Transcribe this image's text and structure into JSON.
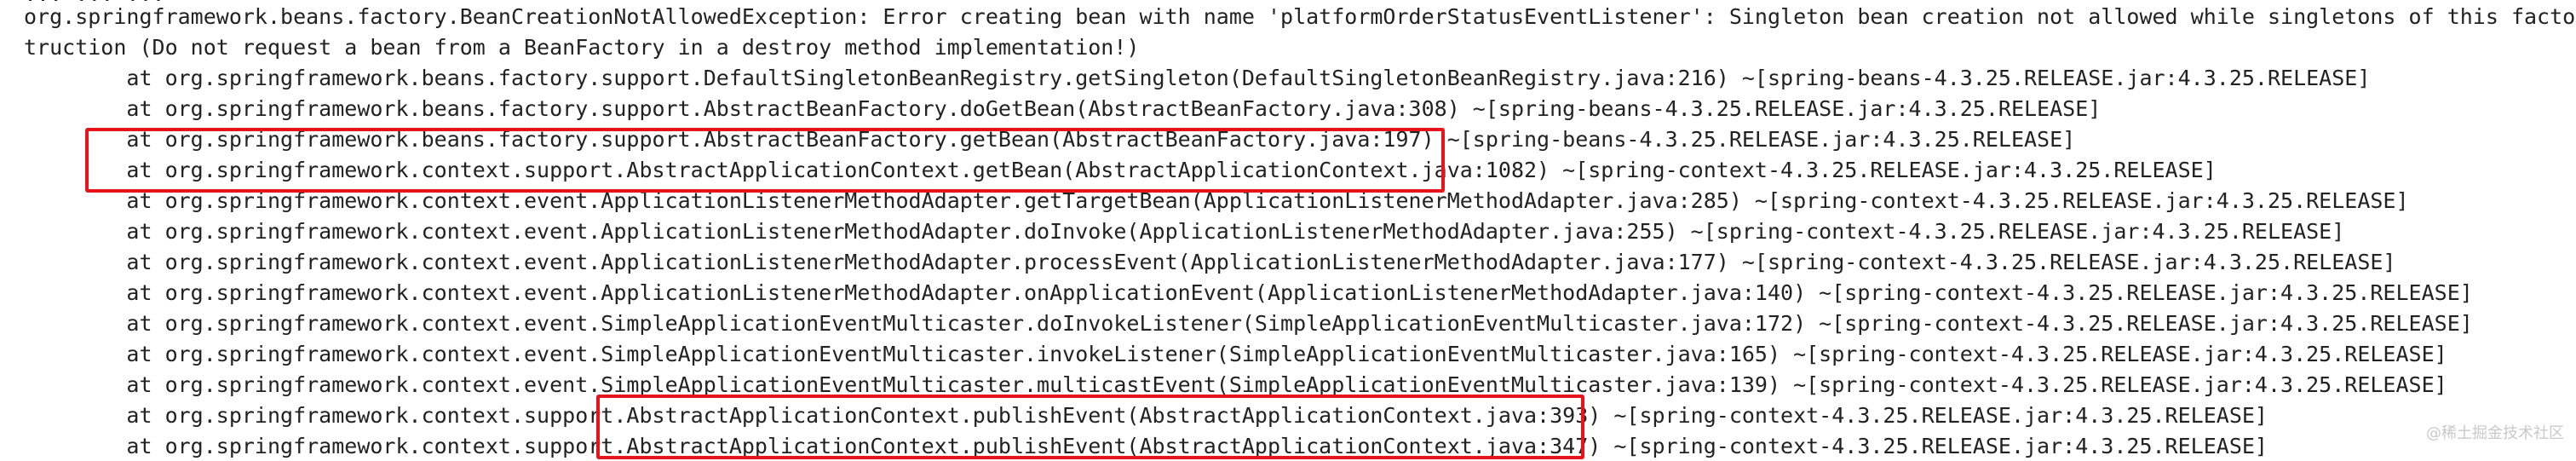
{
  "log": {
    "partial_top_line": "... ... ...",
    "lines": [
      "org.springframework.beans.factory.BeanCreationNotAllowedException: Error creating bean with name 'platformOrderStatusEventListener': Singleton bean creation not allowed while singletons of this factory are in destruction (Do not request a bean from a BeanFactory in a destroy method implementation!)",
      "truction (Do not request a bean from a BeanFactory in a destroy method implementation!)",
      "        at org.springframework.beans.factory.support.DefaultSingletonBeanRegistry.getSingleton(DefaultSingletonBeanRegistry.java:216) ~[spring-beans-4.3.25.RELEASE.jar:4.3.25.RELEASE]",
      "        at org.springframework.beans.factory.support.AbstractBeanFactory.doGetBean(AbstractBeanFactory.java:308) ~[spring-beans-4.3.25.RELEASE.jar:4.3.25.RELEASE]",
      "        at org.springframework.beans.factory.support.AbstractBeanFactory.getBean(AbstractBeanFactory.java:197) ~[spring-beans-4.3.25.RELEASE.jar:4.3.25.RELEASE]",
      "        at org.springframework.context.support.AbstractApplicationContext.getBean(AbstractApplicationContext.java:1082) ~[spring-context-4.3.25.RELEASE.jar:4.3.25.RELEASE]",
      "        at org.springframework.context.event.ApplicationListenerMethodAdapter.getTargetBean(ApplicationListenerMethodAdapter.java:285) ~[spring-context-4.3.25.RELEASE.jar:4.3.25.RELEASE]",
      "        at org.springframework.context.event.ApplicationListenerMethodAdapter.doInvoke(ApplicationListenerMethodAdapter.java:255) ~[spring-context-4.3.25.RELEASE.jar:4.3.25.RELEASE]",
      "        at org.springframework.context.event.ApplicationListenerMethodAdapter.processEvent(ApplicationListenerMethodAdapter.java:177) ~[spring-context-4.3.25.RELEASE.jar:4.3.25.RELEASE]",
      "        at org.springframework.context.event.ApplicationListenerMethodAdapter.onApplicationEvent(ApplicationListenerMethodAdapter.java:140) ~[spring-context-4.3.25.RELEASE.jar:4.3.25.RELEASE]",
      "        at org.springframework.context.event.SimpleApplicationEventMulticaster.doInvokeListener(SimpleApplicationEventMulticaster.java:172) ~[spring-context-4.3.25.RELEASE.jar:4.3.25.RELEASE]",
      "        at org.springframework.context.event.SimpleApplicationEventMulticaster.invokeListener(SimpleApplicationEventMulticaster.java:165) ~[spring-context-4.3.25.RELEASE.jar:4.3.25.RELEASE]",
      "        at org.springframework.context.event.SimpleApplicationEventMulticaster.multicastEvent(SimpleApplicationEventMulticaster.java:139) ~[spring-context-4.3.25.RELEASE.jar:4.3.25.RELEASE]",
      "        at org.springframework.context.support.AbstractApplicationContext.publishEvent(AbstractApplicationContext.java:393) ~[spring-context-4.3.25.RELEASE.jar:4.3.25.RELEASE]",
      "        at org.springframework.context.support.AbstractApplicationContext.publishEvent(AbstractApplicationContext.java:347) ~[spring-context-4.3.25.RELEASE.jar:4.3.25.RELEASE]",
      "        at org.springframework.context.support.AbstractApplicationContext.publishEvent(AbstractApplicationContext.java:347) ~[spring-context-4.3.25.RELEASE.jar:4.3.25.RELEASE]"
    ]
  },
  "watermark": "@稀土掘金技术社区",
  "colors": {
    "highlight": "#e8141b",
    "text": "#222222",
    "background": "#ffffff"
  }
}
